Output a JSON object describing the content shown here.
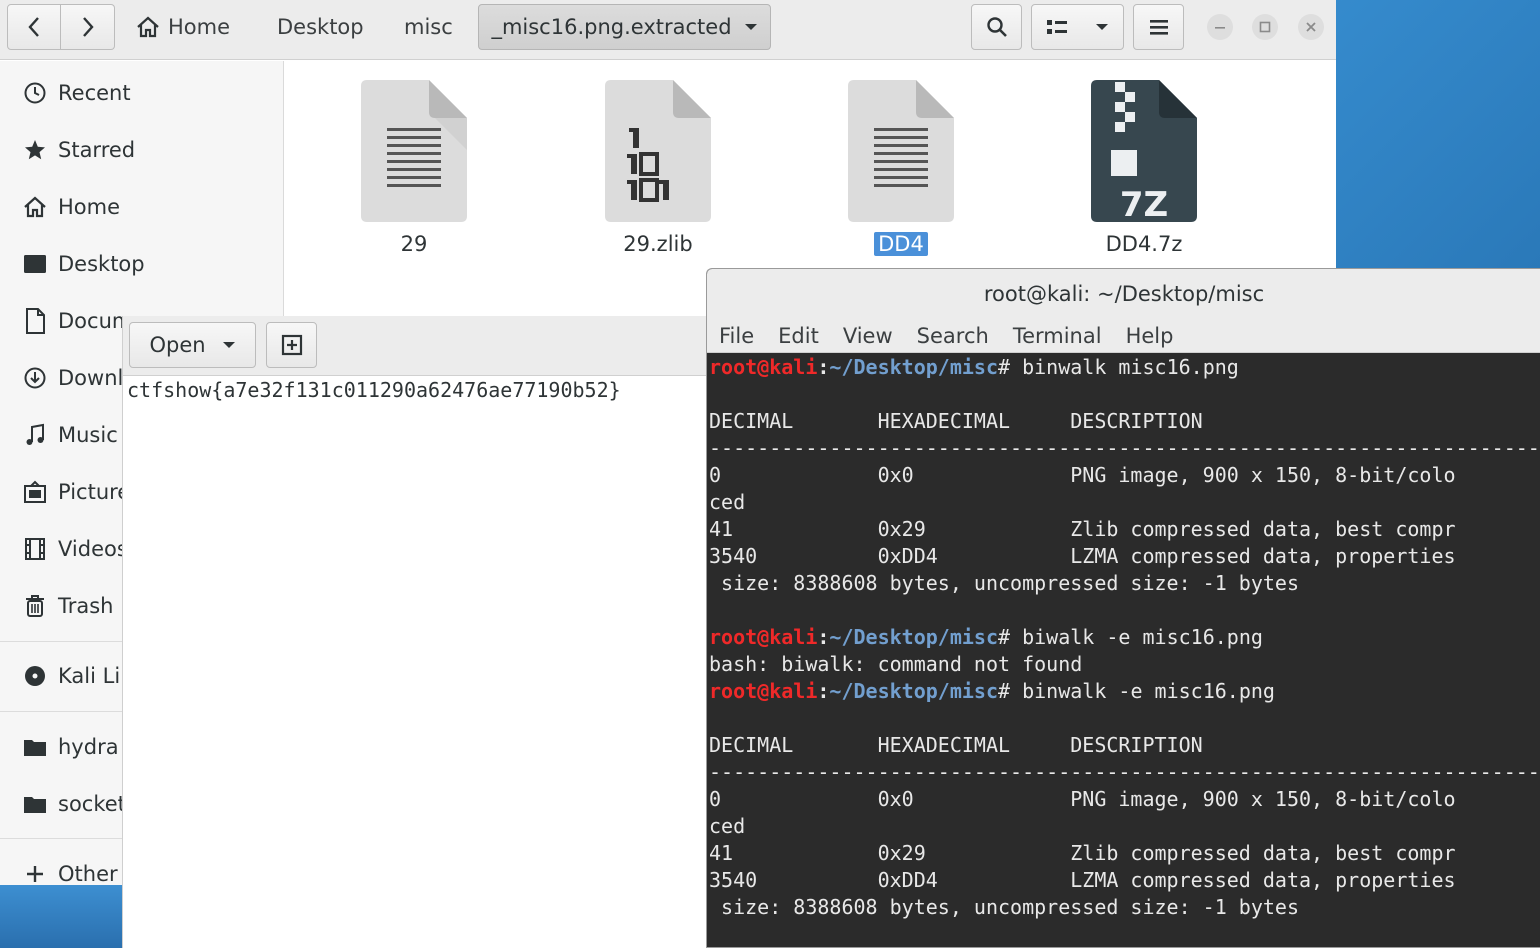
{
  "files_window": {
    "breadcrumb": {
      "home": "Home",
      "desktop": "Desktop",
      "misc": "misc",
      "current": "_misc16.png.extracted"
    },
    "sidebar": [
      {
        "label": "Recent",
        "icon": "clock-icon"
      },
      {
        "label": "Starred",
        "icon": "star-icon"
      },
      {
        "label": "Home",
        "icon": "home-icon"
      },
      {
        "label": "Desktop",
        "icon": "desktop-icon"
      },
      {
        "label": "Docum",
        "icon": "document-icon"
      },
      {
        "label": "Downl",
        "icon": "download-icon"
      },
      {
        "label": "Music",
        "icon": "music-icon"
      },
      {
        "label": "Picture",
        "icon": "picture-icon"
      },
      {
        "label": "Videos",
        "icon": "video-icon"
      },
      {
        "label": "Trash",
        "icon": "trash-icon"
      },
      {
        "label": "Kali Li",
        "icon": "disc-icon"
      },
      {
        "label": "hydra",
        "icon": "folder-icon"
      },
      {
        "label": "socket",
        "icon": "folder-icon"
      },
      {
        "label": "Other l",
        "icon": "plus-icon"
      }
    ],
    "files": [
      {
        "name": "29",
        "type": "text"
      },
      {
        "name": "29.zlib",
        "type": "binary"
      },
      {
        "name": "DD4",
        "type": "text",
        "selected": true
      },
      {
        "name": "DD4.7z",
        "type": "7z"
      }
    ]
  },
  "editor_window": {
    "open_label": "Open",
    "content": "ctfshow{a7e32f131c011290a62476ae77190b52}"
  },
  "terminal_window": {
    "title": "root@kali: ~/Desktop/misc",
    "menu": [
      "File",
      "Edit",
      "View",
      "Search",
      "Terminal",
      "Help"
    ],
    "prompt_user": "root@kali",
    "prompt_path": "~/Desktop/misc",
    "lines": [
      {
        "kind": "prompt",
        "cmd": " binwalk misc16.png"
      },
      {
        "kind": "out",
        "text": ""
      },
      {
        "kind": "out",
        "text": "DECIMAL       HEXADECIMAL     DESCRIPTION"
      },
      {
        "kind": "out",
        "text": "--------------------------------------------------------------------------------"
      },
      {
        "kind": "out",
        "text": "0             0x0             PNG image, 900 x 150, 8-bit/colo"
      },
      {
        "kind": "out",
        "text": "ced"
      },
      {
        "kind": "out",
        "text": "41            0x29            Zlib compressed data, best compr"
      },
      {
        "kind": "out",
        "text": "3540          0xDD4           LZMA compressed data, properties"
      },
      {
        "kind": "out",
        "text": " size: 8388608 bytes, uncompressed size: -1 bytes"
      },
      {
        "kind": "out",
        "text": ""
      },
      {
        "kind": "prompt",
        "cmd": " biwalk -e misc16.png"
      },
      {
        "kind": "out",
        "text": "bash: biwalk: command not found"
      },
      {
        "kind": "prompt",
        "cmd": " binwalk -e misc16.png"
      },
      {
        "kind": "out",
        "text": ""
      },
      {
        "kind": "out",
        "text": "DECIMAL       HEXADECIMAL     DESCRIPTION"
      },
      {
        "kind": "out",
        "text": "--------------------------------------------------------------------------------"
      },
      {
        "kind": "out",
        "text": "0             0x0             PNG image, 900 x 150, 8-bit/colo"
      },
      {
        "kind": "out",
        "text": "ced"
      },
      {
        "kind": "out",
        "text": "41            0x29            Zlib compressed data, best compr"
      },
      {
        "kind": "out",
        "text": "3540          0xDD4           LZMA compressed data, properties"
      },
      {
        "kind": "out",
        "text": " size: 8388608 bytes, uncompressed size: -1 bytes"
      }
    ]
  },
  "colors": {
    "selection": "#4a90d9",
    "prompt_user": "#ef2929",
    "prompt_path": "#729fcf",
    "terminal_bg": "#2b2b2b"
  }
}
